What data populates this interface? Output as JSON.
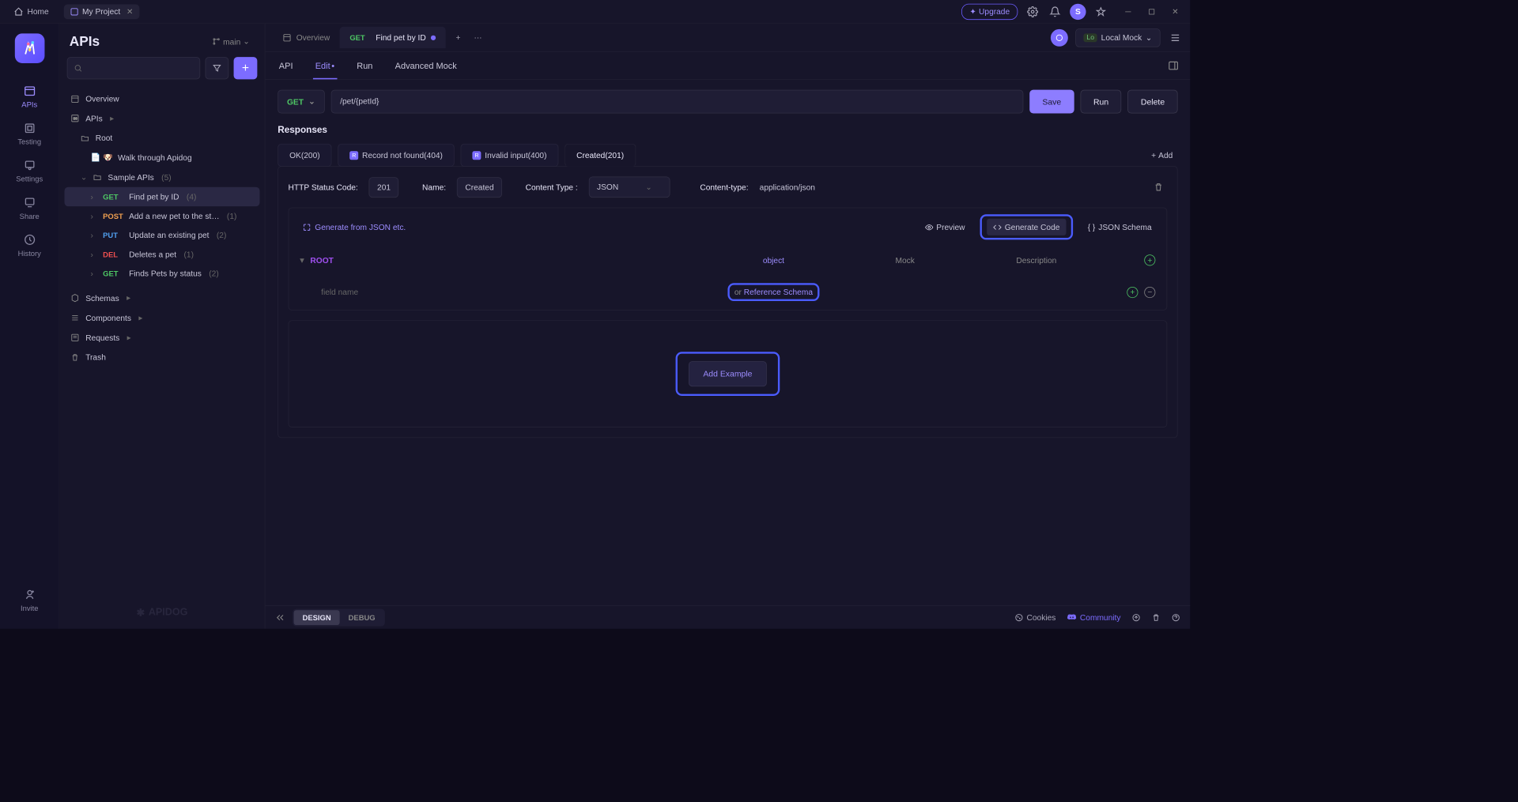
{
  "titlebar": {
    "home": "Home",
    "project": "My Project",
    "upgrade": "Upgrade",
    "avatar": "S"
  },
  "rail": {
    "apis": "APIs",
    "testing": "Testing",
    "settings": "Settings",
    "share": "Share",
    "history": "History",
    "invite": "Invite"
  },
  "sidebar": {
    "title": "APIs",
    "branch": "main",
    "overview": "Overview",
    "apis_label": "APIs",
    "root": "Root",
    "walkthrough": "Walk through Apidog",
    "sample_apis": "Sample APIs",
    "sample_apis_count": "(5)",
    "endpoints": [
      {
        "method": "GET",
        "label": "Find pet by ID",
        "count": "(4)"
      },
      {
        "method": "POST",
        "label": "Add a new pet to the st…",
        "count": "(1)"
      },
      {
        "method": "PUT",
        "label": "Update an existing pet",
        "count": "(2)"
      },
      {
        "method": "DEL",
        "label": "Deletes a pet",
        "count": "(1)"
      },
      {
        "method": "GET",
        "label": "Finds Pets by status",
        "count": "(2)"
      }
    ],
    "schemas": "Schemas",
    "components": "Components",
    "requests": "Requests",
    "trash": "Trash",
    "brand": "APIDOG"
  },
  "tabs": {
    "overview": "Overview",
    "active_method": "GET",
    "active_label": "Find pet by ID",
    "env": "Local Mock",
    "env_badge": "Lo"
  },
  "subtabs": {
    "api": "API",
    "edit": "Edit",
    "run": "Run",
    "advanced": "Advanced Mock"
  },
  "url_row": {
    "method": "GET",
    "path": "/pet/{petId}",
    "save": "Save",
    "run": "Run",
    "delete": "Delete"
  },
  "responses": {
    "title": "Responses",
    "tabs": [
      {
        "label": "OK(200)",
        "badge": false
      },
      {
        "label": "Record not found(404)",
        "badge": true
      },
      {
        "label": "Invalid input(400)",
        "badge": true
      },
      {
        "label": "Created(201)",
        "badge": false
      }
    ],
    "add": "Add",
    "meta": {
      "status_label": "HTTP Status Code:",
      "status_value": "201",
      "name_label": "Name:",
      "name_value": "Created",
      "ctype_label": "Content Type :",
      "ctype_value": "JSON",
      "ctype2_label": "Content-type:",
      "ctype2_value": "application/json"
    },
    "toolbar": {
      "generate": "Generate from JSON etc.",
      "preview": "Preview",
      "gencode": "Generate Code",
      "jsonschema": "JSON Schema"
    },
    "schema": {
      "root": "ROOT",
      "type": "object",
      "mock": "Mock",
      "description": "Description",
      "field_placeholder": "field name",
      "ref_prefix": "or",
      "ref_schema": "Reference Schema"
    },
    "add_example": "Add Example"
  },
  "footer": {
    "design": "DESIGN",
    "debug": "DEBUG",
    "cookies": "Cookies",
    "community": "Community"
  }
}
